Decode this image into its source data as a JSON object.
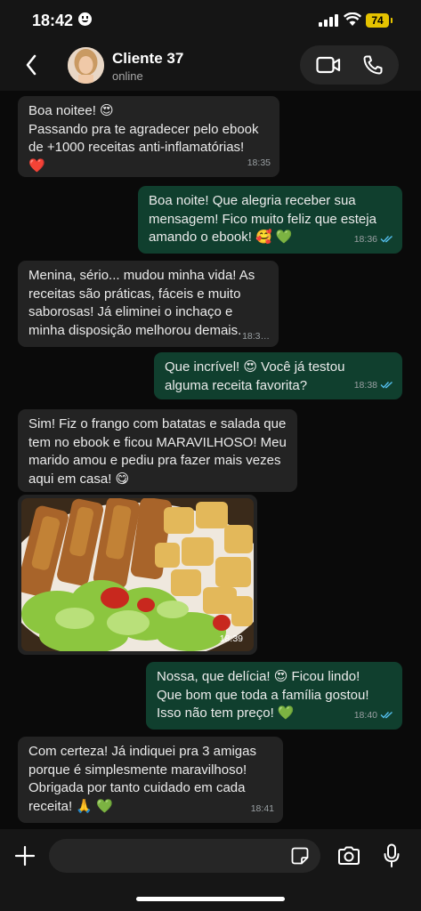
{
  "status_bar": {
    "time": "18:42",
    "battery": "74"
  },
  "header": {
    "name": "Cliente 37",
    "status": "online"
  },
  "messages": [
    {
      "text": "Boa noitee! 😍\nPassando pra te agradecer pelo ebook de +1000 receitas anti-inflamatórias!\n❤️",
      "time": "18:35"
    },
    {
      "text": "Boa noite! Que alegria receber sua mensagem! Fico muito feliz que esteja amando o ebook! 🥰 💚",
      "time": "18:36"
    },
    {
      "text": "Menina, sério... mudou minha vida! As receitas são práticas, fáceis e muito saborosas! Já eliminei o inchaço e minha disposição melhorou demais.",
      "time": "18:3…"
    },
    {
      "text": "Que incrível! 😍 Você já testou alguma receita favorita?",
      "time": "18:38"
    },
    {
      "text": "Sim! Fiz o frango com batatas e salada que tem no ebook e ficou MARAVILHOSO! Meu marido amou e pediu pra fazer mais vezes aqui em casa! 😋",
      "time": ""
    },
    {
      "text": "",
      "time": "18:39"
    },
    {
      "text": "Nossa, que delícia! 😍 Ficou lindo!\nQue bom que toda a família gostou!\nIsso não tem preço! 💚",
      "time": "18:40"
    },
    {
      "text": "Com certeza! Já indiquei pra 3 amigas porque é simplesmente maravilhoso! Obrigada por tanto cuidado em cada receita! 🙏 💚",
      "time": "18:41"
    }
  ],
  "icons": {
    "back": "chevron-left-icon",
    "video": "video-call-icon",
    "phone": "phone-icon",
    "plus": "plus-icon",
    "sticker": "sticker-icon",
    "camera": "camera-icon",
    "mic": "microphone-icon",
    "read": "double-check-icon"
  },
  "colors": {
    "incoming_bubble": "#232323",
    "outgoing_bubble": "#103f2e",
    "read_check": "#53bdeb",
    "battery": "#e5c300"
  }
}
